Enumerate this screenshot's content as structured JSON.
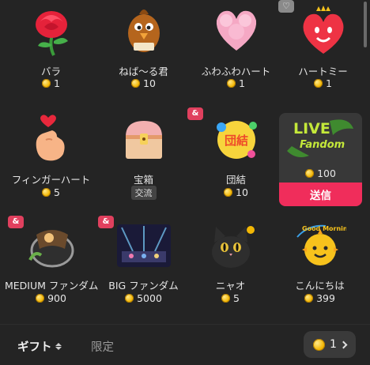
{
  "gifts": [
    {
      "name": "バラ",
      "price": "1",
      "icon": "rose-icon"
    },
    {
      "name": "ねば〜る君",
      "price": "10",
      "icon": "nebaru-kun-icon"
    },
    {
      "name": "ふわふわハート",
      "price": "1",
      "icon": "fluffy-heart-icon"
    },
    {
      "name": "ハートミー",
      "price": "1",
      "icon": "heart-me-icon"
    },
    {
      "name": "フィンガーハート",
      "price": "5",
      "icon": "finger-heart-icon"
    },
    {
      "name": "宝箱",
      "tag": "交流",
      "icon": "treasure-chest-icon"
    },
    {
      "name": "団結",
      "price": "10",
      "icon": "unity-icon",
      "logo_text": "団結"
    },
    {
      "price": "100",
      "icon": "live-fandom-icon",
      "logo_text": [
        "LIVE",
        "Fandom"
      ]
    },
    {
      "name": "MEDIUM ファンダム",
      "price": "900",
      "icon": "medium-fandom-icon"
    },
    {
      "name": "BIG ファンダム",
      "price": "5000",
      "icon": "big-fandom-icon"
    },
    {
      "name": "ニャオ",
      "price": "5",
      "icon": "cat-icon"
    },
    {
      "name": "こんにちは",
      "price": "399",
      "icon": "hello-sun-icon",
      "logo_text": "Good Morning"
    }
  ],
  "selected": {
    "send_label": "送信"
  },
  "footer": {
    "tab_gift": "ギフト",
    "tab_limited": "限定",
    "balance": "1"
  },
  "colors": {
    "accent": "#f02d5b",
    "background": "#242424",
    "coin": "#f2b705"
  }
}
